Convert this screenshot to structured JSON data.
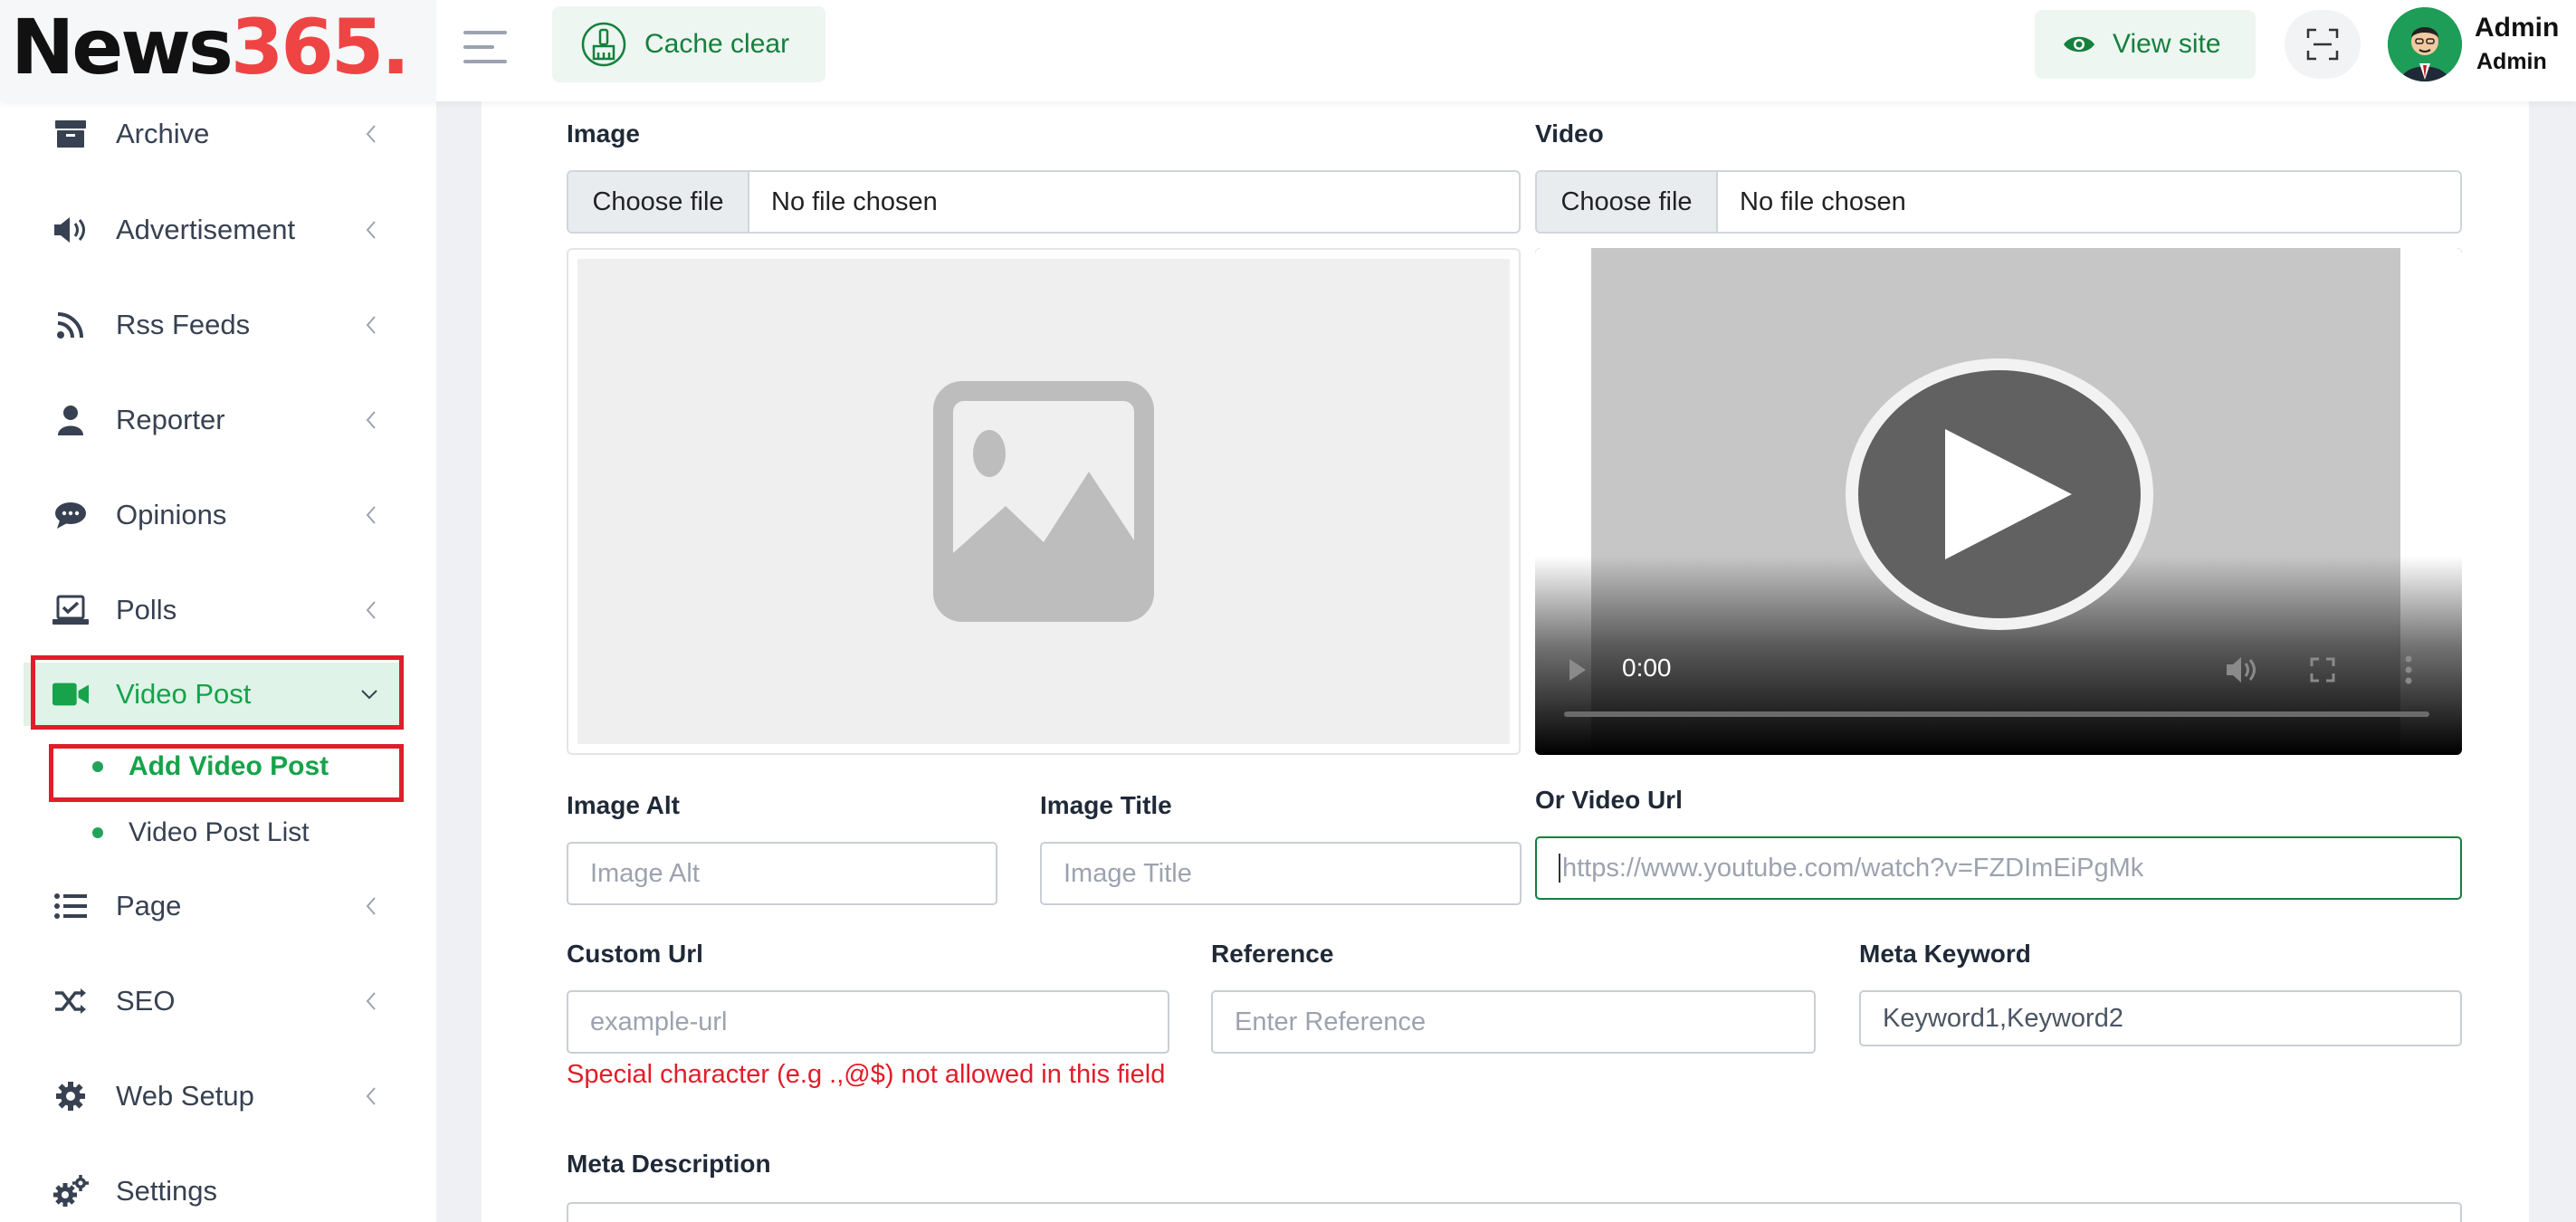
{
  "header": {
    "logo_part1": "News",
    "logo_part2": "365.",
    "cache_clear_label": "Cache clear",
    "view_site_label": "View site",
    "user_name": "Admin",
    "user_role": "Admin"
  },
  "sidebar": {
    "items": [
      {
        "label": "Archive",
        "icon": "archive-icon"
      },
      {
        "label": "Advertisement",
        "icon": "megaphone-icon"
      },
      {
        "label": "Rss Feeds",
        "icon": "rss-icon"
      },
      {
        "label": "Reporter",
        "icon": "user-icon"
      },
      {
        "label": "Opinions",
        "icon": "comments-icon"
      },
      {
        "label": "Polls",
        "icon": "poll-icon"
      },
      {
        "label": "Video Post",
        "icon": "video-camera-icon",
        "active": true
      },
      {
        "label": "Page",
        "icon": "list-icon"
      },
      {
        "label": "SEO",
        "icon": "shuffle-icon"
      },
      {
        "label": "Web Setup",
        "icon": "gear-icon"
      },
      {
        "label": "Settings",
        "icon": "gears-icon"
      }
    ],
    "sub_items": [
      {
        "label": "Add Video Post",
        "active": true
      },
      {
        "label": "Video Post List",
        "active": false
      }
    ]
  },
  "form": {
    "image_label": "Image",
    "image_file_button": "Choose file",
    "image_file_text": "No file chosen",
    "video_label": "Video",
    "video_file_button": "Choose file",
    "video_file_text": "No file chosen",
    "video_time": "0:00",
    "image_alt_label": "Image Alt",
    "image_alt_placeholder": "Image Alt",
    "image_title_label": "Image Title",
    "image_title_placeholder": "Image Title",
    "video_url_label": "Or Video Url",
    "video_url_placeholder": "https://www.youtube.com/watch?v=FZDImEiPgMk",
    "custom_url_label": "Custom Url",
    "custom_url_placeholder": "example-url",
    "custom_url_error": "Special character (e.g .,@$) not allowed in this field",
    "reference_label": "Reference",
    "reference_placeholder": "Enter Reference",
    "meta_keyword_label": "Meta Keyword",
    "meta_keyword_value": "Keyword1,Keyword2",
    "meta_description_label": "Meta Description"
  },
  "colors": {
    "accent": "#16a34a",
    "highlight_border": "#e11d2a",
    "logo_red": "#ef4444"
  }
}
